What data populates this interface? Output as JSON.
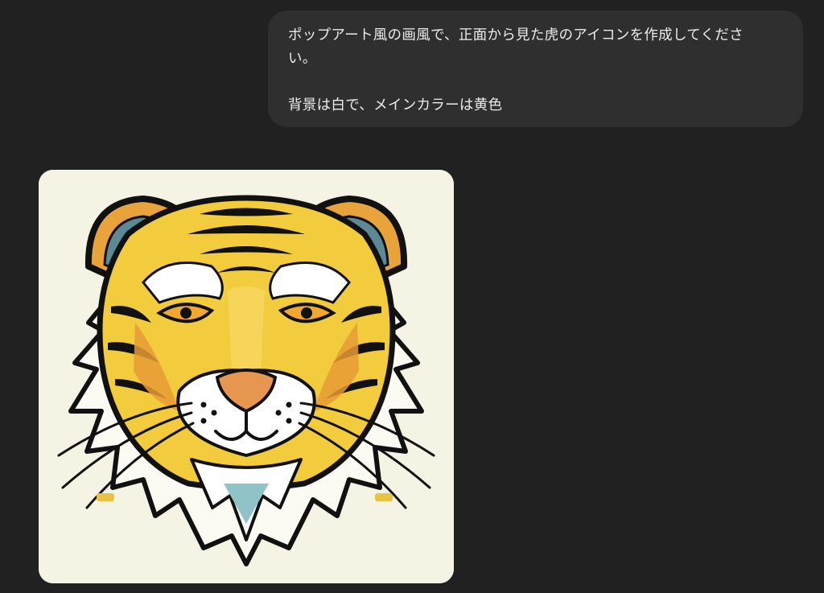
{
  "user_message": {
    "line1": "ポップアート風の画風で、正面から見た虎のアイコンを作成してくださ",
    "line2": "い。",
    "line3": "背景は白で、メインカラーは黄色"
  },
  "generated_image": {
    "subject_icon": "tiger-face-icon",
    "background_color": "#f5f3e4",
    "main_color": "#f2cc3c"
  },
  "colors": {
    "page_background": "#212121",
    "bubble_background": "#2f2f2f",
    "bubble_text": "#ececec"
  }
}
